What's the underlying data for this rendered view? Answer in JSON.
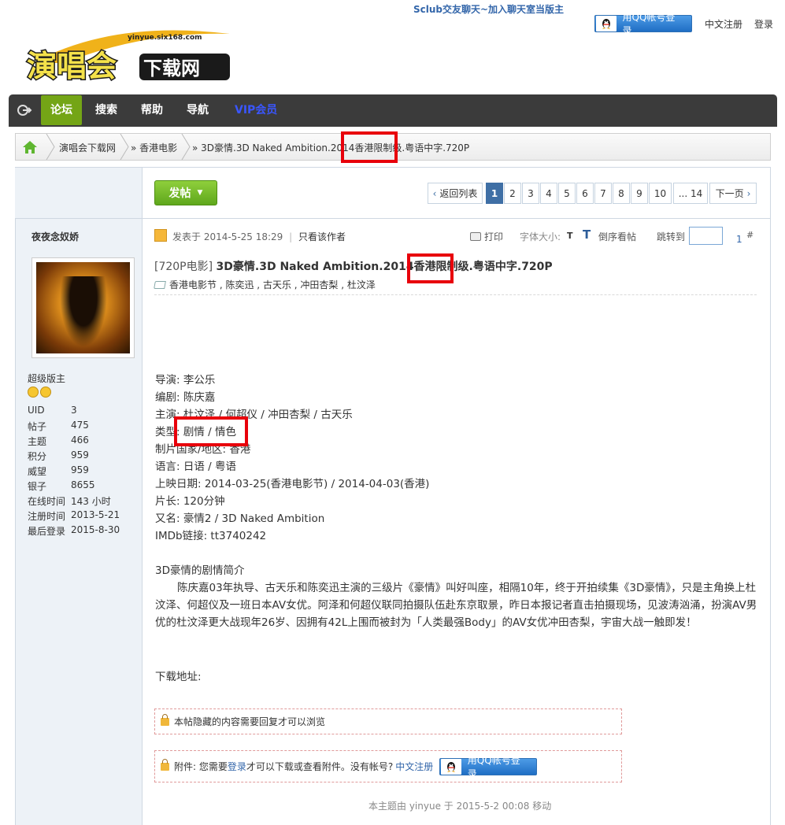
{
  "header": {
    "promo_link": "Sclub交友聊天~加入聊天室当版主",
    "qq_login": "用QQ帐号登录",
    "register": "中文注册",
    "login": "登录",
    "logo_text": "演唱会下载网",
    "logo_url_text": "yinyue.six168.com"
  },
  "nav": {
    "items": [
      {
        "label": "论坛"
      },
      {
        "label": "搜索"
      },
      {
        "label": "帮助"
      },
      {
        "label": "导航"
      },
      {
        "label": "VIP会员"
      }
    ]
  },
  "breadcrumb": {
    "items": [
      {
        "label": "演唱会下载网"
      },
      {
        "label": "» 香港电影"
      },
      {
        "label": "» 3D豪情.3D Naked Ambition.2014香港限制级.粤语中字.720P"
      }
    ]
  },
  "toolbar": {
    "post_button": "发帖",
    "back_to_list": "返回列表",
    "pages": [
      "1",
      "2",
      "3",
      "4",
      "5",
      "6",
      "7",
      "8",
      "9",
      "10",
      "... 14"
    ],
    "next_page": "下一页"
  },
  "author": {
    "name": "夜夜念奴娇",
    "rank": "超级版主",
    "stats": [
      {
        "k": "UID",
        "v": "3"
      },
      {
        "k": "帖子",
        "v": "475"
      },
      {
        "k": "主题",
        "v": "466"
      },
      {
        "k": "积分",
        "v": "959"
      },
      {
        "k": "威望",
        "v": "959"
      },
      {
        "k": "银子",
        "v": "8655"
      },
      {
        "k": "在线时间",
        "v": "143 小时"
      },
      {
        "k": "注册时间",
        "v": "2013-5-21"
      },
      {
        "k": "最后登录",
        "v": "2015-8-30"
      }
    ]
  },
  "post": {
    "meta": "发表于 2014-5-25 18:29",
    "only_author": "只看该作者",
    "print": "打印",
    "font_size": "字体大小:",
    "font_t": "T",
    "reverse": "倒序看帖",
    "jump": "跳转到",
    "floor_num": "1",
    "floor_sym": "#",
    "category": "[720P电影]",
    "title": "3D豪情.3D Naked Ambition.2014香港限制级.粤语中字.720P",
    "tags": [
      "香港电影节",
      "陈奕迅",
      "古天乐",
      "冲田杏梨",
      "杜汶泽"
    ],
    "info_lines": [
      "导演: 李公乐",
      "编剧: 陈庆嘉",
      "主演: 杜汶泽 / 何超仪 / 冲田杏梨 / 古天乐",
      "类型: 剧情 / 情色",
      "制片国家/地区: 香港",
      "语言: 日语 / 粤语",
      "上映日期: 2014-03-25(香港电影节) / 2014-04-03(香港)",
      "片长: 120分钟",
      "又名: 豪情2 / 3D Naked Ambition",
      "IMDb链接: tt3740242"
    ],
    "synopsis_title": "3D豪情的剧情简介",
    "synopsis": "陈庆嘉03年执导、古天乐和陈奕迅主演的三级片《豪情》叫好叫座，相隔10年，终于开拍续集《3D豪情》，只是主角换上杜汶泽、何超仪及一班日本AV女优。阿泽和何超仪联同拍摄队伍赴东京取景，昨日本报记者直击拍摄现场，见波涛汹涌，扮演AV男优的杜汶泽更大战现年26岁、因拥有42L上围而被封为「人类最强Body」的AV女优冲田杏梨，宇宙大战一触即发！",
    "download_label": "下载地址:",
    "hidden_notice": "本帖隐藏的内容需要回复才可以浏览",
    "attach_prefix": "附件: 您需要",
    "attach_login": "登录",
    "attach_mid": "才可以下载或查看附件。没有帐号?",
    "attach_register": "中文注册",
    "moved_note": "本主题由 yinyue 于 2015-5-2 00:08 移动"
  },
  "colors": {
    "nav_bg": "#3b3b3b",
    "nav_active": "#74a516",
    "highlight": "#e8000b",
    "vip": "#3a56ff"
  }
}
